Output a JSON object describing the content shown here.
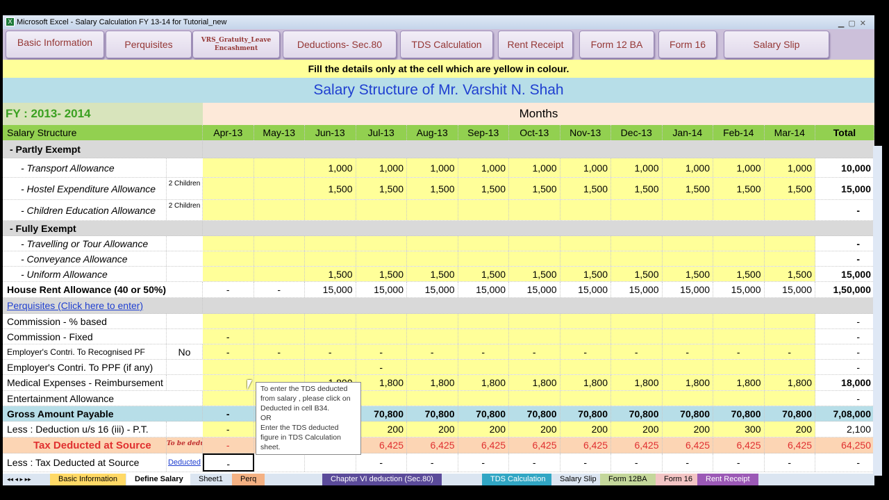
{
  "window": {
    "title": "Microsoft Excel - Salary Calculation FY 13-14 for Tutorial_new"
  },
  "nav_buttons": [
    "Basic Information",
    "Perquisites",
    "VRS_Gratuity_Leave Encashment",
    "Deductions- Sec.80",
    "TDS Calculation",
    "Rent Receipt",
    "Form 12 BA",
    "Form 16",
    "Salary Slip"
  ],
  "note": "Fill the details only at the cell which are yellow in colour.",
  "title": "Salary Structure of Mr. Varshit N. Shah",
  "fy": "FY : 2013- 2014",
  "months_label": "Months",
  "header": {
    "label": "Salary Structure",
    "months": [
      "Apr-13",
      "May-13",
      "Jun-13",
      "Jul-13",
      "Aug-13",
      "Sep-13",
      "Oct-13",
      "Nov-13",
      "Dec-13",
      "Jan-14",
      "Feb-14",
      "Mar-14"
    ],
    "total": "Total"
  },
  "rows": [
    {
      "label": " - Partly Exempt",
      "type": "sec",
      "side": "",
      "values": [],
      "total": ""
    },
    {
      "label": "- Transport Allowance",
      "type": "it",
      "side": "",
      "values": [
        "",
        "",
        "1,000",
        "1,000",
        "1,000",
        "1,000",
        "1,000",
        "1,000",
        "1,000",
        "1,000",
        "1,000",
        "1,000"
      ],
      "total": "10,000"
    },
    {
      "label": "- Hostel Expenditure Allowance",
      "type": "it",
      "side": "2 Children",
      "values": [
        "",
        "",
        "1,500",
        "1,500",
        "1,500",
        "1,500",
        "1,500",
        "1,500",
        "1,500",
        "1,500",
        "1,500",
        "1,500"
      ],
      "total": "15,000"
    },
    {
      "label": "- Children Education Allowance",
      "type": "it",
      "side": "2 Children",
      "values": [],
      "total": "-"
    },
    {
      "label": " - Fully Exempt",
      "type": "sec",
      "side": "",
      "values": [],
      "total": ""
    },
    {
      "label": "- Travelling or Tour Allowance",
      "type": "it",
      "side": "",
      "values": [],
      "total": "-"
    },
    {
      "label": "- Conveyance Allowance",
      "type": "it",
      "side": "",
      "values": [],
      "total": "-"
    },
    {
      "label": "- Uniform Allowance",
      "type": "it",
      "side": "",
      "values": [
        "",
        "",
        "1,500",
        "1,500",
        "1,500",
        "1,500",
        "1,500",
        "1,500",
        "1,500",
        "1,500",
        "1,500",
        "1,500"
      ],
      "total": "15,000"
    },
    {
      "label": "House Rent Allowance (40 or 50%)",
      "type": "bold",
      "side": "",
      "values": [
        "-",
        "-",
        "15,000",
        "15,000",
        "15,000",
        "15,000",
        "15,000",
        "15,000",
        "15,000",
        "15,000",
        "15,000",
        "15,000"
      ],
      "total": "1,50,000"
    },
    {
      "label": "Perquisites (Click here to enter)",
      "type": "link",
      "side": "",
      "values": [],
      "total": ""
    },
    {
      "label": "Commission - % based",
      "type": "norm",
      "side": "",
      "values": [],
      "total": "-"
    },
    {
      "label": "Commission - Fixed",
      "type": "norm",
      "side": "",
      "values": [
        "-"
      ],
      "total": "-"
    },
    {
      "label": "Employer's Contri. To Recognised PF",
      "type": "smallf",
      "side": "No",
      "values": [
        "-",
        "-",
        "-",
        "-",
        "-",
        "-",
        "-",
        "-",
        "-",
        "-",
        "-",
        "-"
      ],
      "total": "-"
    },
    {
      "label": "Employer's Contri. To PPF (if any)",
      "type": "norm",
      "side": "",
      "values": [
        "",
        "",
        "",
        "-"
      ],
      "total": "-"
    },
    {
      "label": "Medical Expenses - Reimbursement",
      "type": "norm",
      "side": "",
      "values": [
        "",
        "",
        "1,800",
        "1,800",
        "1,800",
        "1,800",
        "1,800",
        "1,800",
        "1,800",
        "1,800",
        "1,800",
        "1,800"
      ],
      "total": "18,000"
    },
    {
      "label": "Entertainment Allowance",
      "type": "norm",
      "side": "",
      "values": [],
      "total": "-"
    },
    {
      "label": "Gross Amount Payable",
      "type": "gross",
      "side": "",
      "values": [
        "-",
        "",
        "",
        "70,800",
        "70,800",
        "70,800",
        "70,800",
        "70,800",
        "70,800",
        "70,800",
        "70,800",
        "70,800"
      ],
      "total": "7,08,000"
    },
    {
      "label": "Less : Deduction u/s 16 (iii) - P.T.",
      "type": "norm",
      "side": "",
      "values": [
        "-",
        "",
        "",
        "200",
        "200",
        "200",
        "200",
        "200",
        "200",
        "200",
        "300",
        "200"
      ],
      "total": "2,100"
    },
    {
      "label": "Tax Deducted at Source",
      "type": "tds",
      "side": "To be deducted",
      "values": [
        "-",
        "",
        "",
        "6,425",
        "6,425",
        "6,425",
        "6,425",
        "6,425",
        "6,425",
        "6,425",
        "6,425",
        "6,425"
      ],
      "total": "64,250"
    },
    {
      "label": "Less : Tax Deducted at Source",
      "type": "norm",
      "side": "Deducted",
      "values": [
        "-",
        "",
        "",
        "-",
        "-",
        "-",
        "-",
        "-",
        "-",
        "-",
        "-",
        "-"
      ],
      "total": "-"
    }
  ],
  "tooltip": [
    "To enter the TDS deducted from salary , please click on Deducted in cell B34.",
    "OR",
    "Enter the TDS deducted figure in TDS Calculation sheet."
  ],
  "sheet_tabs": [
    "Basic Information",
    "Define Salary",
    "Sheet1",
    "Perq",
    "Chapter VI deduction (Sec.80)",
    "TDS Calculation",
    "Salary Slip",
    "Form 12BA",
    "Form 16",
    "Rent Receipt"
  ],
  "active_tab": "Define Salary",
  "colors": {
    "yellow": "#ffff99",
    "header_green": "#92d050",
    "title_blue": "#1f3fd0",
    "tds_red": "#e03030"
  }
}
